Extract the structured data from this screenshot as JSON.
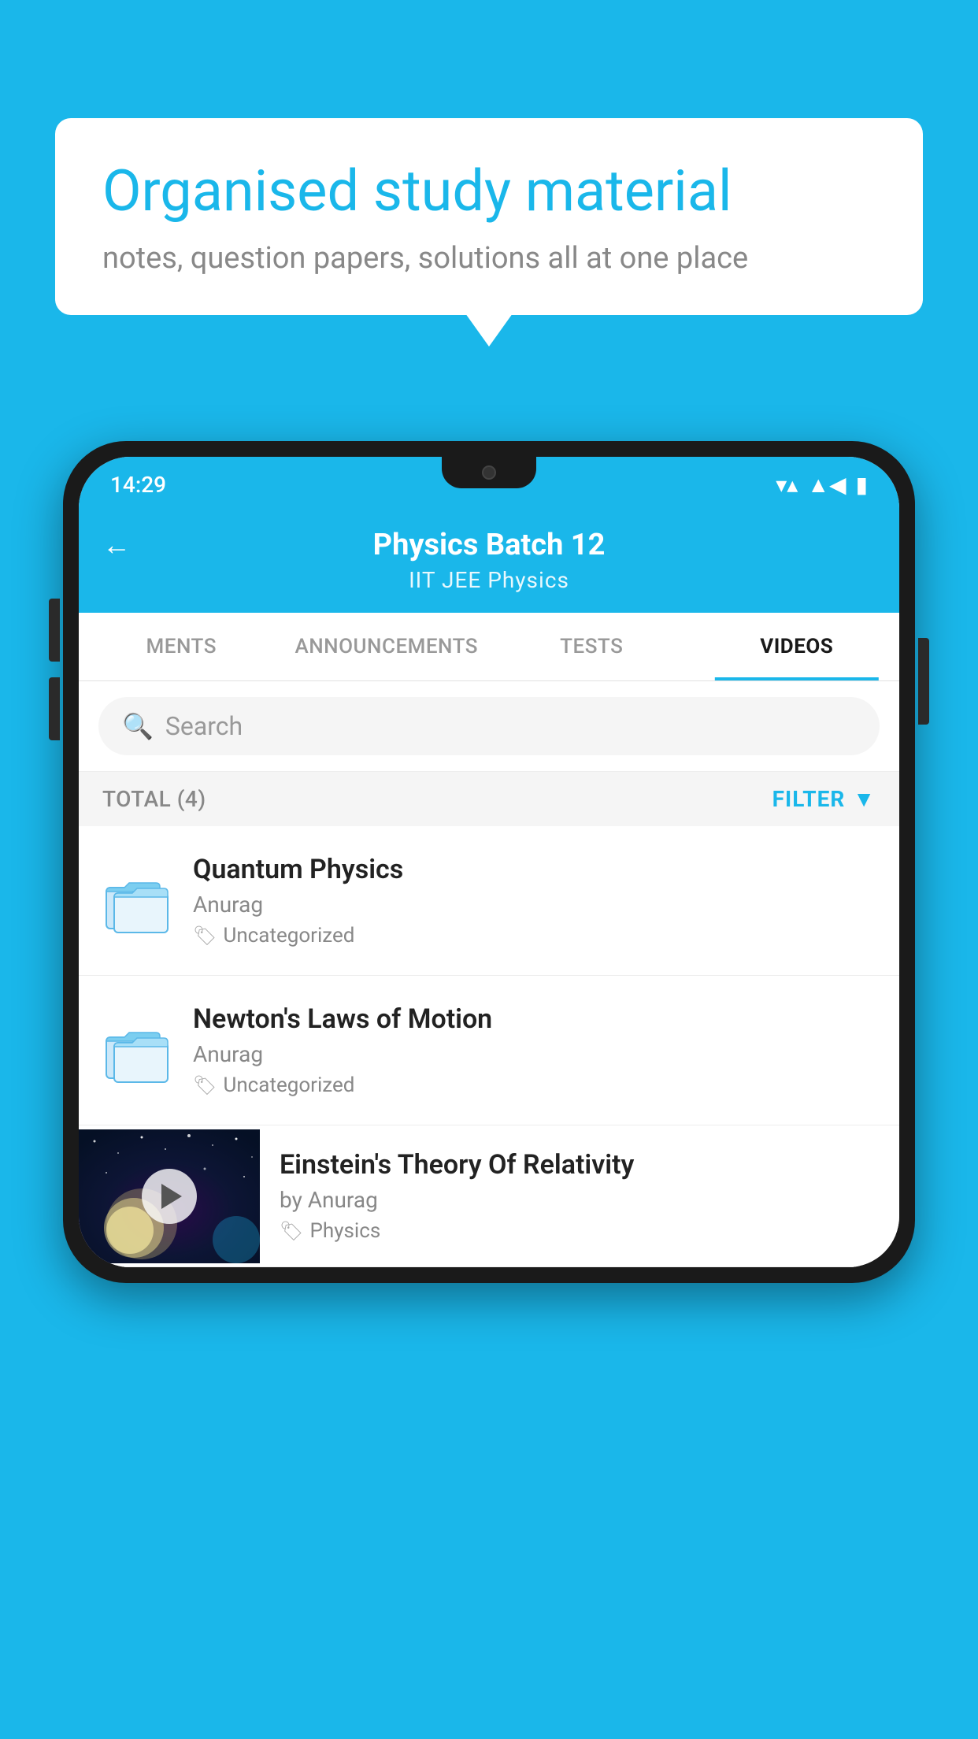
{
  "background_color": "#1ab7ea",
  "speech_bubble": {
    "title": "Organised study material",
    "subtitle": "notes, question papers, solutions all at one place"
  },
  "phone": {
    "status_bar": {
      "time": "14:29",
      "icons": [
        "wifi",
        "signal",
        "battery"
      ]
    },
    "header": {
      "back_label": "←",
      "title": "Physics Batch 12",
      "subtitle": "IIT JEE    Physics"
    },
    "tabs": [
      {
        "label": "MENTS",
        "active": false
      },
      {
        "label": "ANNOUNCEMENTS",
        "active": false
      },
      {
        "label": "TESTS",
        "active": false
      },
      {
        "label": "VIDEOS",
        "active": true
      }
    ],
    "search": {
      "placeholder": "Search"
    },
    "filter_row": {
      "total_label": "TOTAL (4)",
      "filter_label": "FILTER"
    },
    "videos": [
      {
        "id": 1,
        "title": "Quantum Physics",
        "author": "Anurag",
        "tag": "Uncategorized",
        "type": "folder"
      },
      {
        "id": 2,
        "title": "Newton's Laws of Motion",
        "author": "Anurag",
        "tag": "Uncategorized",
        "type": "folder"
      },
      {
        "id": 3,
        "title": "Einstein's Theory Of Relativity",
        "author": "by Anurag",
        "tag": "Physics",
        "type": "video"
      }
    ]
  }
}
